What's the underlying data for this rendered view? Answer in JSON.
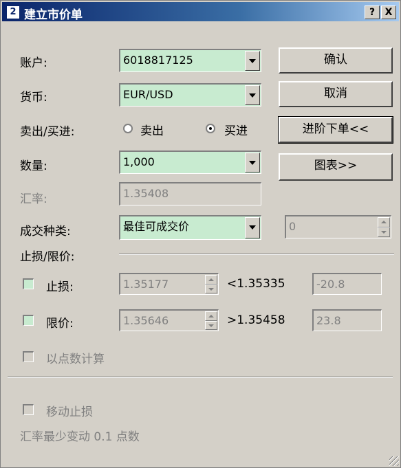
{
  "window": {
    "title": "建立市价单",
    "help_label": "?",
    "close_label": "X"
  },
  "form": {
    "account_label": "账户:",
    "account_value": "6018817125",
    "currency_label": "货币:",
    "currency_value": "EUR/USD",
    "direction_label": "卖出/买进:",
    "sell_label": "卖出",
    "buy_label": "买进",
    "selected_direction": "买进",
    "quantity_label": "数量:",
    "quantity_value": "1,000",
    "rate_label": "汇率:",
    "rate_value": "1.35408",
    "order_type_label": "成交种类:",
    "order_type_value": "最佳可成交价",
    "slippage_value": "0",
    "stop_limit_label": "止损/限价:",
    "stop_label": "止损:",
    "stop_rate": "1.35177",
    "stop_condition": "<1.35335",
    "stop_pips": "-20.8",
    "limit_label": "限价:",
    "limit_rate": "1.35646",
    "limit_condition": ">1.35458",
    "limit_pips": "23.8",
    "points_calc_label": "以点数计算",
    "trailing_stop_label": "移动止损",
    "min_move_text": "汇率最少变动 0.1 点数"
  },
  "buttons": {
    "ok": "确认",
    "cancel": "取消",
    "advanced": "进阶下单<<",
    "chart": "图表>>"
  },
  "colors": {
    "field_green": "#c8ebd0",
    "window_gray": "#d4d0c8",
    "title_blue": "#0a246a"
  }
}
